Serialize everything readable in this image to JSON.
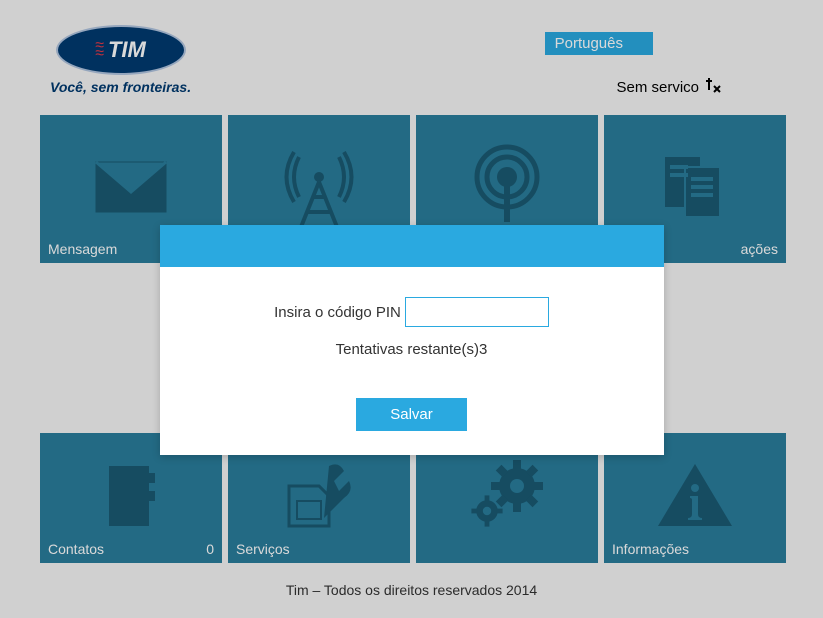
{
  "header": {
    "logo_brand": "TIM",
    "logo_tagline": "Você, sem fronteiras.",
    "language": "Português",
    "status_text": "Sem servico"
  },
  "tiles": {
    "row1": [
      {
        "label": "Mensagem",
        "icon": "envelope"
      },
      {
        "label": "",
        "icon": "antenna"
      },
      {
        "label": "",
        "icon": "broadcast"
      },
      {
        "label": "ações",
        "icon": "documents"
      }
    ],
    "row2": [
      {
        "label": "Contatos",
        "count": "0",
        "icon": "addressbook"
      },
      {
        "label": "Serviços",
        "icon": "sim-wrench"
      },
      {
        "label": "",
        "icon": "gears"
      },
      {
        "label": "Informações",
        "icon": "info-triangle"
      }
    ]
  },
  "modal": {
    "pin_label": "Insira o código PIN",
    "pin_value": "",
    "attempts_label": "Tentativas restante(s)",
    "attempts_count": "3",
    "save_button": "Salvar"
  },
  "footer": {
    "copyright": "Tim – Todos os direitos reservados 2014"
  }
}
